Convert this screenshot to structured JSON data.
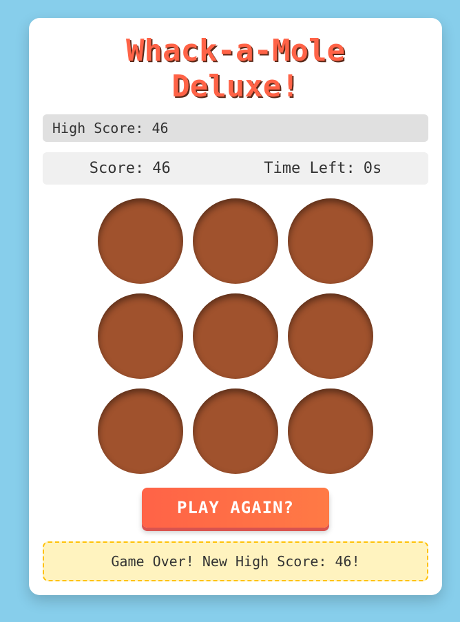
{
  "game": {
    "title_line1": "Whack-a-Mole",
    "title_line2": "Deluxe!",
    "high_score_label": "High Score:",
    "high_score_value": "46",
    "score_label": "Score:",
    "score_value": "46",
    "time_label": "Time Left:",
    "time_value": "0s",
    "holes": [
      "",
      "",
      "",
      "",
      "",
      "",
      "",
      "",
      ""
    ],
    "play_button_label": "PLAY AGAIN?",
    "message": "Game Over! New High Score: 46!"
  },
  "colors": {
    "background": "#87ceeb",
    "title": "#ff6347",
    "hole": "#a0522d",
    "button": "#ff6347",
    "message_bg": "#fff3bf",
    "message_border": "#ffc107"
  }
}
